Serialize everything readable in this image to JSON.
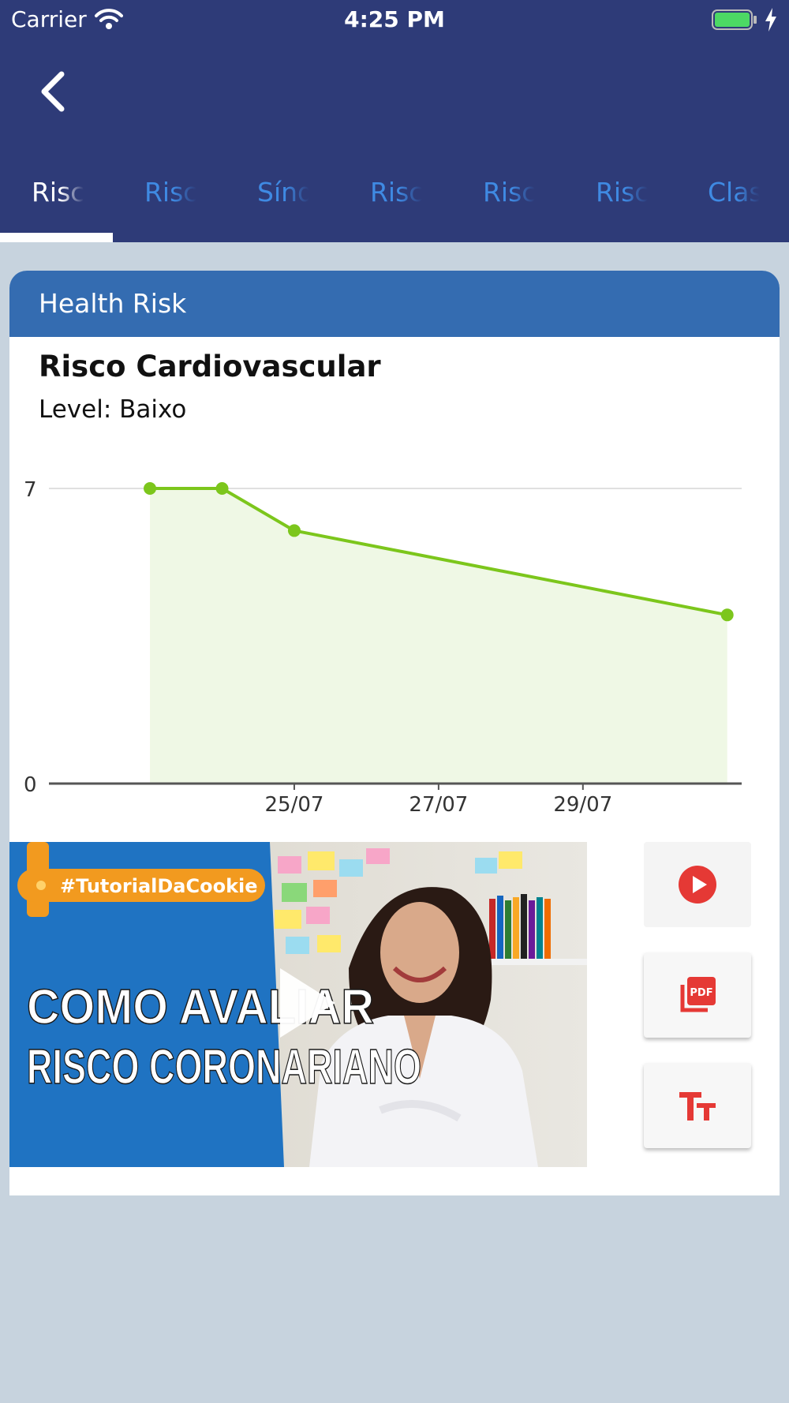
{
  "status_bar": {
    "carrier": "Carrier",
    "time": "4:25 PM"
  },
  "nav": {
    "back_icon": "chevron-left-icon",
    "tabs": [
      {
        "label": "Risco",
        "active": true
      },
      {
        "label": "Risco",
        "active": false
      },
      {
        "label": "Síndrome",
        "active": false
      },
      {
        "label": "Risco",
        "active": false
      },
      {
        "label": "Risco",
        "active": false
      },
      {
        "label": "Risco",
        "active": false
      },
      {
        "label": "Classificação",
        "active": false
      }
    ]
  },
  "card": {
    "header": "Health Risk",
    "title": "Risco Cardiovascular",
    "level": "Level: Baixo",
    "video": {
      "tag": "#TutorialDaCookie",
      "line1": "COMO AVALIAR",
      "line2": "RISCO CORONARIANO",
      "play_icon": "play-icon"
    },
    "actions": [
      {
        "name": "play-video-button",
        "icon": "play-circle-icon"
      },
      {
        "name": "pdf-button",
        "icon": "pdf-icon"
      },
      {
        "name": "text-size-button",
        "icon": "text-size-icon"
      }
    ]
  },
  "chart_data": {
    "type": "area",
    "x": [
      "23/07",
      "24/07",
      "25/07",
      "31/07"
    ],
    "series": [
      {
        "values": [
          7,
          7,
          6,
          4
        ]
      }
    ],
    "x_tick_labels": [
      "25/07",
      "27/07",
      "29/07"
    ],
    "y_tick_labels": [
      "7",
      "0"
    ],
    "ylim": [
      0,
      7
    ],
    "xlim": [
      "22/07",
      "31/07"
    ],
    "grid": true,
    "colors": {
      "line": "#7cc61c",
      "fill": "#eff8e5"
    }
  },
  "colors": {
    "header_bg": "#2e3b78",
    "card_header_bg": "#346cb1",
    "page_bg": "#c7d3de",
    "accent_red": "#e53935"
  }
}
